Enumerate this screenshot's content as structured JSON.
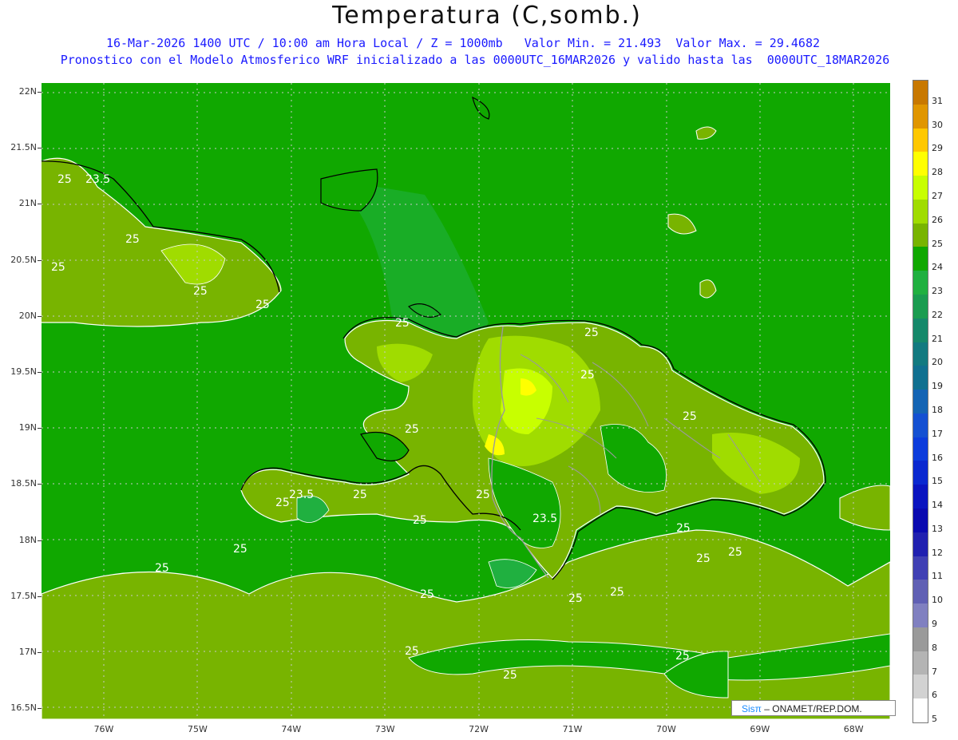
{
  "title": "Temperatura (C,somb.)",
  "subtitle_1": "16-Mar-2026 1400 UTC / 10:00 am Hora Local / Z = 1000mb   Valor Min. = 21.493  Valor Max. = 29.4682",
  "subtitle_2": "Pronostico con el Modelo Atmosferico WRF inicializado a las 0000UTC_16MAR2026 y valido hasta las  0000UTC_18MAR2026",
  "lat_labels": [
    "22N",
    "21.5N",
    "21N",
    "20.5N",
    "20N",
    "19.5N",
    "19N",
    "18.5N",
    "18N",
    "17.5N",
    "17N",
    "16.5N"
  ],
  "lon_labels": [
    "76W",
    "75W",
    "74W",
    "73W",
    "72W",
    "71W",
    "70W",
    "69W",
    "68W"
  ],
  "colorbar": {
    "labels": [
      "31",
      "30",
      "29",
      "28",
      "27",
      "26",
      "25",
      "24",
      "23",
      "22",
      "21",
      "20",
      "19",
      "18",
      "17",
      "16",
      "15",
      "14",
      "13",
      "12",
      "11",
      "10",
      "9",
      "8",
      "7",
      "6",
      "5"
    ],
    "colors": [
      "#c87800",
      "#e09600",
      "#ffc800",
      "#ffff00",
      "#c8ff00",
      "#a0dc00",
      "#78b400",
      "#10a800",
      "#20b040",
      "#1a9c50",
      "#15886a",
      "#127a80",
      "#107090",
      "#1464b4",
      "#1450d2",
      "#0c3cdc",
      "#0a28d0",
      "#0a14c0",
      "#0a0ab0",
      "#2020b0",
      "#4040b4",
      "#6060b4",
      "#8080c0",
      "#9a9a9a",
      "#b4b4b4",
      "#d2d2d2",
      "#ffffff"
    ]
  },
  "contour_labels": [
    "25",
    "23.5",
    "25",
    "25",
    "25",
    "25",
    "25",
    "25",
    "25",
    "25",
    "25",
    "25",
    "23.5",
    "25",
    "25",
    "25",
    "23.5",
    "25",
    "25",
    "25",
    "25",
    "25",
    "25",
    "25",
    "25",
    "25",
    "25",
    "25"
  ],
  "credit": {
    "brand": "Sisπ",
    "text": " – ONAMET/REP.DOM."
  }
}
